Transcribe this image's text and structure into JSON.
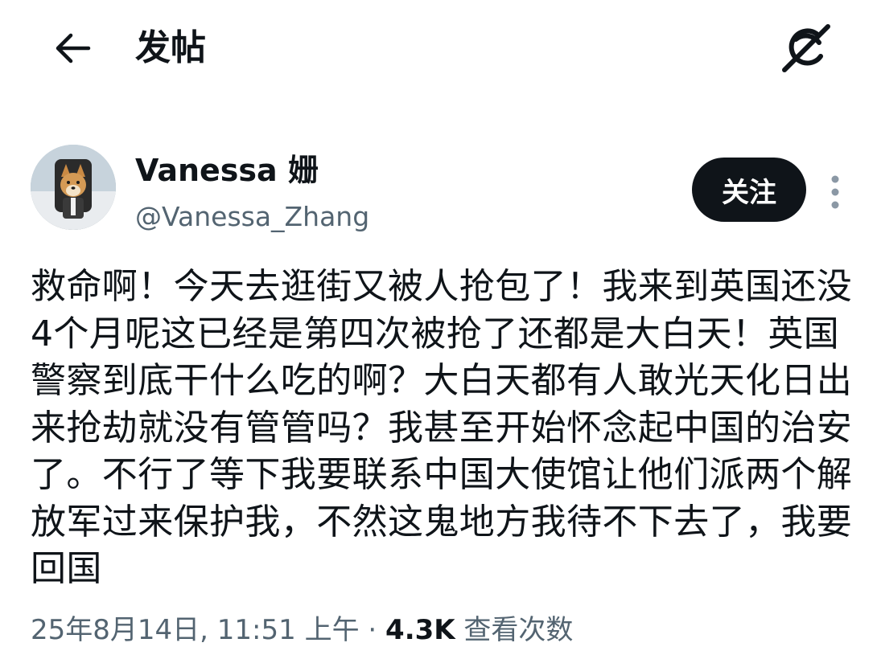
{
  "header": {
    "title": "发帖",
    "back_icon": "arrow-left-icon",
    "grok_icon": "grok-icon"
  },
  "author": {
    "display_name": "Vanessa 姗",
    "handle": "@Vanessa_Zhang",
    "avatar_icon": "shiba-dog-avatar",
    "follow_label": "关注",
    "more_icon": "vertical-dots-icon"
  },
  "post": {
    "text": "救命啊！今天去逛街又被人抢包了！我来到英国还没4个月呢这已经是第四次被抢了还都是大白天！英国警察到底干什么吃的啊？大白天都有人敢光天化日出来抢劫就没有管管吗？我甚至开始怀念起中国的治安了。不行了等下我要联系中国大使馆让他们派两个解放军过来保护我，不然这鬼地方我待不下去了，我要回国"
  },
  "meta": {
    "date": "25年8月14日",
    "time": "11:51 上午",
    "separator": "·",
    "views_count": "4.3K",
    "views_label": "查看次数"
  },
  "colors": {
    "text": "#0f1419",
    "secondary": "#536471",
    "button_bg": "#0f1419",
    "background": "#ffffff"
  }
}
